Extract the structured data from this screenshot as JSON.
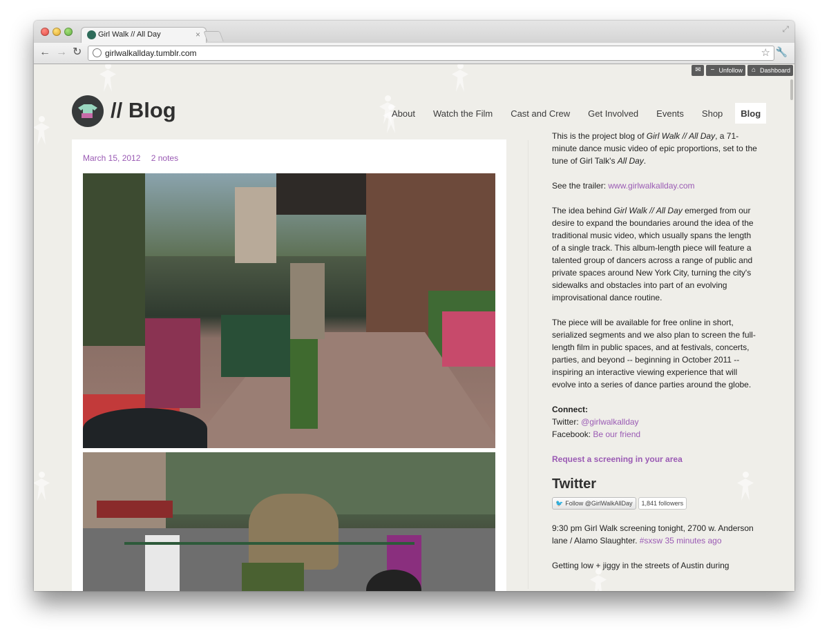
{
  "browser": {
    "tab_title": "Girl Walk // All Day",
    "url": "girlwalkallday.tumblr.com"
  },
  "tumblr_controls": {
    "unfollow": "Unfollow",
    "dashboard": "Dashboard"
  },
  "site": {
    "title": "// Blog"
  },
  "nav": [
    {
      "label": "About"
    },
    {
      "label": "Watch the Film"
    },
    {
      "label": "Cast and Crew"
    },
    {
      "label": "Get Involved"
    },
    {
      "label": "Events"
    },
    {
      "label": "Shop"
    },
    {
      "label": "Blog",
      "active": true
    }
  ],
  "post": {
    "date": "March 15, 2012",
    "notes": "2 notes"
  },
  "sidebar": {
    "intro_pre": "This is the project blog of ",
    "intro_title": "Girl Walk // All Day",
    "intro_mid": ", a 71-minute dance music video of epic proportions, set to the tune of Girl Talk's ",
    "intro_album": "All Day",
    "intro_end": ".",
    "trailer_label": "See the trailer: ",
    "trailer_link": "www.girlwalkallday.com",
    "idea_pre": "The idea behind ",
    "idea_title": "Girl Walk // All Day",
    "idea_text": " emerged from our desire to expand the boundaries around the idea of the traditional music video, which usually spans the length of a single track. This album-length piece will feature a talented group of dancers across a range of public and private spaces around New York City, turning the city's sidewalks and obstacles into part of an evolving improvisational dance routine.",
    "piece_text": "The piece will be available for free online in short, serialized segments and we also plan to screen the full-length film in public spaces, and at festivals, concerts, parties, and beyond -- beginning in October 2011 -- inspiring an interactive viewing experience that will evolve into a series of dance parties around the globe.",
    "connect_head": "Connect:",
    "twitter_label": "Twitter: ",
    "twitter_handle": "@girlwalkallday",
    "facebook_label": "Facebook: ",
    "facebook_link": "Be our friend",
    "request": "Request a screening in your area",
    "twitter_heading": "Twitter",
    "follow_button": "Follow @GirlWalkAllDay",
    "followers": "1,841 followers",
    "tweet1_text": "9:30 pm Girl Walk screening tonight, 2700 w. Anderson lane / Alamo Slaughter. ",
    "tweet1_tag": "#sxsw",
    "tweet1_time": "35 minutes ago",
    "tweet2_text": "Getting low + jiggy in the streets of Austin during"
  },
  "colors": {
    "accent": "#9a5ab4",
    "page_background": "#efeee9",
    "text": "#222222"
  },
  "icons": [
    "globe-icon",
    "star-icon",
    "wrench-icon",
    "mail-icon",
    "minus-icon",
    "home-icon",
    "twitter-bird-icon"
  ]
}
